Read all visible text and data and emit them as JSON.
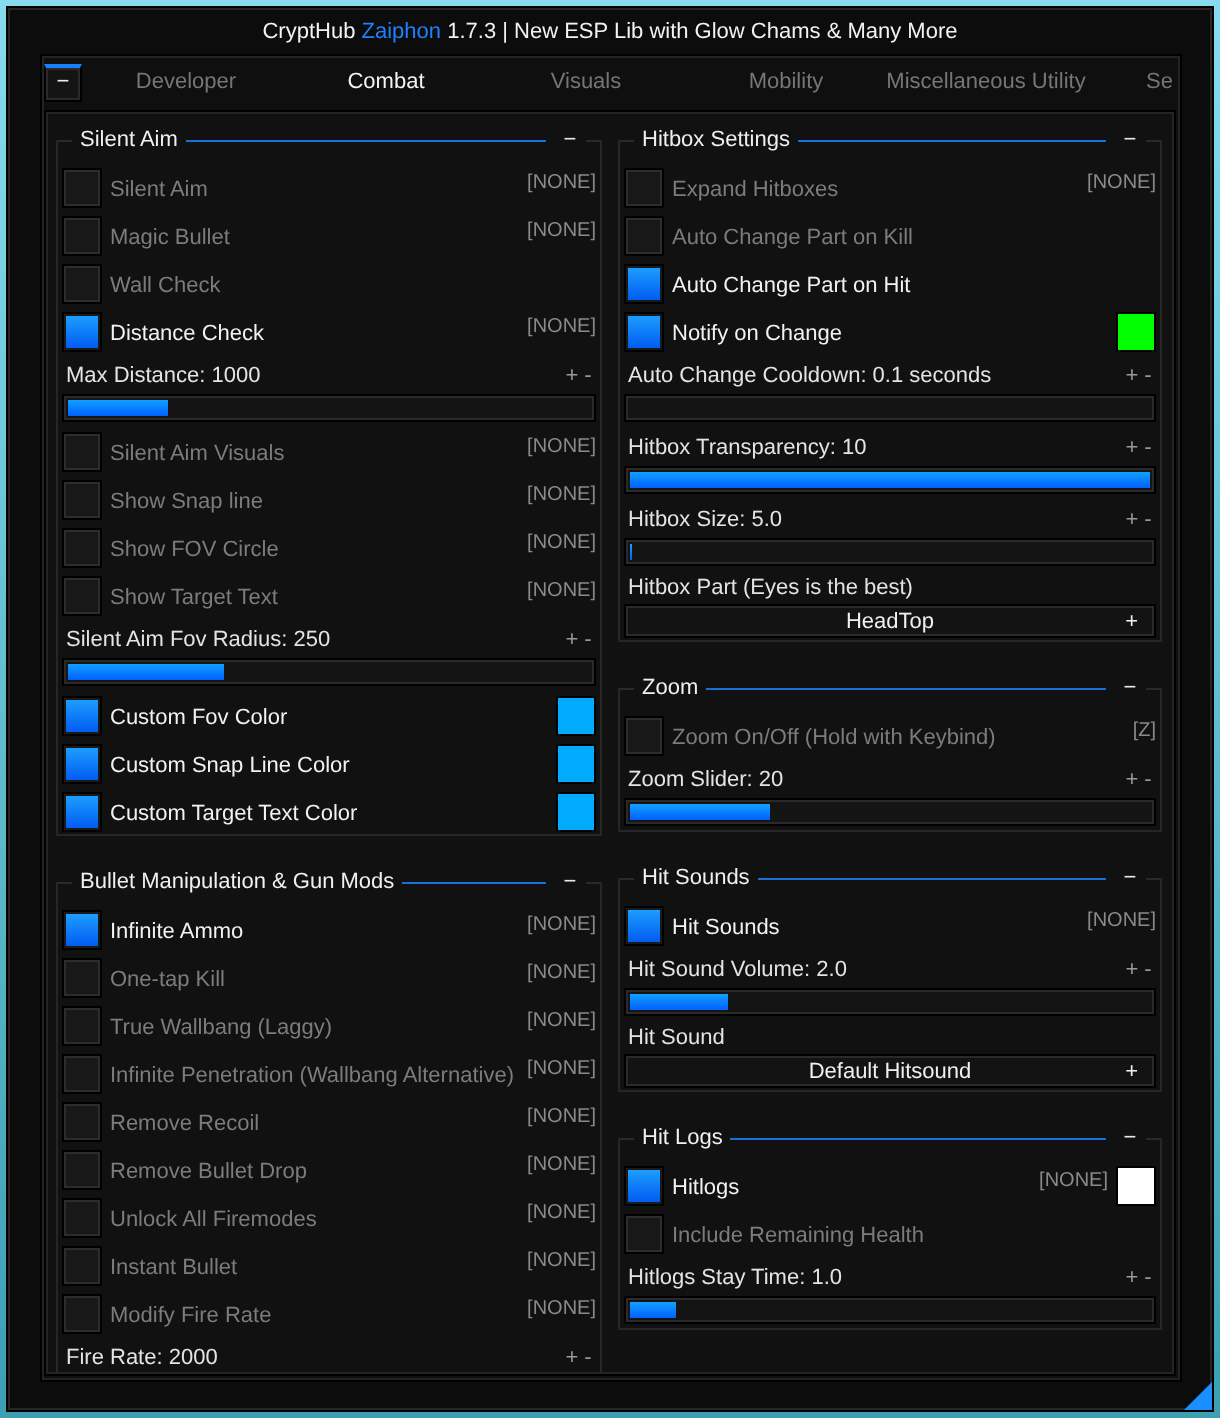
{
  "window": {
    "title": {
      "app": "CryptHub",
      "highlight": "Zaiphon",
      "rest": "1.7.3 | New ESP Lib with Glow Chams & Many More"
    },
    "collapse": "−"
  },
  "tabs": [
    {
      "label": "Developer",
      "selected": false
    },
    {
      "label": "Combat",
      "selected": true
    },
    {
      "label": "Visuals",
      "selected": false
    },
    {
      "label": "Mobility",
      "selected": false
    },
    {
      "label": "Miscellaneous Utility",
      "selected": false
    },
    {
      "label": "Se",
      "selected": false
    }
  ],
  "columns": [
    {
      "sections": [
        {
          "title": "Silent Aim",
          "collapse": "−",
          "items": [
            {
              "kind": "toggle",
              "label": "Silent Aim",
              "checked": false,
              "keybind": "[NONE]"
            },
            {
              "kind": "toggle",
              "label": "Magic Bullet",
              "checked": false,
              "keybind": "[NONE]"
            },
            {
              "kind": "toggle",
              "label": "Wall Check",
              "checked": false
            },
            {
              "kind": "toggle",
              "label": "Distance Check",
              "checked": true,
              "keybind": "[NONE]"
            },
            {
              "kind": "slider",
              "label": "Max Distance: 1000",
              "increase": "+",
              "decrease": "-",
              "level": 0.19
            },
            {
              "kind": "toggle",
              "label": "Silent Aim Visuals",
              "checked": false,
              "keybind": "[NONE]"
            },
            {
              "kind": "toggle",
              "label": "Show Snap line",
              "checked": false,
              "keybind": "[NONE]"
            },
            {
              "kind": "toggle",
              "label": "Show FOV Circle",
              "checked": false,
              "keybind": "[NONE]"
            },
            {
              "kind": "toggle",
              "label": "Show Target Text",
              "checked": false,
              "keybind": "[NONE]"
            },
            {
              "kind": "slider",
              "label": "Silent Aim Fov Radius: 250",
              "increase": "+",
              "decrease": "-",
              "level": 0.3
            },
            {
              "kind": "toggle",
              "label": "Custom Fov Color",
              "checked": true,
              "color": "#00aaff"
            },
            {
              "kind": "toggle",
              "label": "Custom Snap Line Color",
              "checked": true,
              "color": "#00aaff"
            },
            {
              "kind": "toggle",
              "label": "Custom Target Text Color",
              "checked": true,
              "color": "#00aaff"
            }
          ]
        },
        {
          "title": "Bullet Manipulation & Gun Mods",
          "collapse": "−",
          "items": [
            {
              "kind": "toggle",
              "label": "Infinite Ammo",
              "checked": true,
              "keybind": "[NONE]"
            },
            {
              "kind": "toggle",
              "label": "One-tap Kill",
              "checked": false,
              "keybind": "[NONE]"
            },
            {
              "kind": "toggle",
              "label": "True Wallbang (Laggy)",
              "checked": false,
              "keybind": "[NONE]"
            },
            {
              "kind": "toggle",
              "label": "Infinite Penetration (Wallbang Alternative)",
              "checked": false,
              "keybind": "[NONE]"
            },
            {
              "kind": "toggle",
              "label": "Remove Recoil",
              "checked": false,
              "keybind": "[NONE]"
            },
            {
              "kind": "toggle",
              "label": "Remove Bullet Drop",
              "checked": false,
              "keybind": "[NONE]"
            },
            {
              "kind": "toggle",
              "label": "Unlock All Firemodes",
              "checked": false,
              "keybind": "[NONE]"
            },
            {
              "kind": "toggle",
              "label": "Instant Bullet",
              "checked": false,
              "keybind": "[NONE]"
            },
            {
              "kind": "toggle",
              "label": "Modify Fire Rate",
              "checked": false,
              "keybind": "[NONE]"
            },
            {
              "kind": "slider",
              "label": "Fire Rate: 2000",
              "increase": "+",
              "decrease": "-"
            }
          ]
        }
      ]
    },
    {
      "sections": [
        {
          "title": "Hitbox Settings",
          "collapse": "−",
          "items": [
            {
              "kind": "toggle",
              "label": "Expand Hitboxes",
              "checked": false,
              "keybind": "[NONE]"
            },
            {
              "kind": "toggle",
              "label": "Auto Change Part on Kill",
              "checked": false
            },
            {
              "kind": "toggle",
              "label": "Auto Change Part on Hit",
              "checked": true
            },
            {
              "kind": "toggle",
              "label": "Notify on Change",
              "checked": true,
              "color": "#00ff00"
            },
            {
              "kind": "slider",
              "label": "Auto Change Cooldown: 0.1 seconds",
              "increase": "+",
              "decrease": "-",
              "level": 0
            },
            {
              "kind": "slider",
              "label": "Hitbox Transparency: 10",
              "increase": "+",
              "decrease": "-",
              "level": 1
            },
            {
              "kind": "slider",
              "label": "Hitbox Size: 5.0",
              "increase": "+",
              "decrease": "-",
              "level": 0.005
            },
            {
              "kind": "dropdown",
              "label": "Hitbox Part (Eyes is the best)",
              "value": "HeadTop",
              "expand": "+"
            }
          ]
        },
        {
          "title": "Zoom",
          "collapse": "−",
          "items": [
            {
              "kind": "toggle",
              "label": "Zoom On/Off (Hold with Keybind)",
              "checked": false,
              "keybind": "[Z]"
            },
            {
              "kind": "slider",
              "label": "Zoom Slider: 20",
              "increase": "+",
              "decrease": "-",
              "level": 0.27
            }
          ]
        },
        {
          "title": "Hit Sounds",
          "collapse": "−",
          "items": [
            {
              "kind": "toggle",
              "label": "Hit Sounds",
              "checked": true,
              "keybind": "[NONE]"
            },
            {
              "kind": "slider",
              "label": "Hit Sound Volume: 2.0",
              "increase": "+",
              "decrease": "-",
              "level": 0.19
            },
            {
              "kind": "dropdown",
              "label": "Hit Sound",
              "value": "Default Hitsound",
              "expand": "+"
            }
          ]
        },
        {
          "title": "Hit Logs",
          "collapse": "−",
          "items": [
            {
              "kind": "toggle",
              "label": "Hitlogs",
              "checked": true,
              "keybind": "[NONE]",
              "color": "#ffffff"
            },
            {
              "kind": "toggle",
              "label": "Include Remaining Health",
              "checked": false
            },
            {
              "kind": "slider",
              "label": "Hitlogs Stay Time: 1.0",
              "increase": "+",
              "decrease": "-",
              "level": 0.09
            }
          ]
        }
      ]
    }
  ]
}
